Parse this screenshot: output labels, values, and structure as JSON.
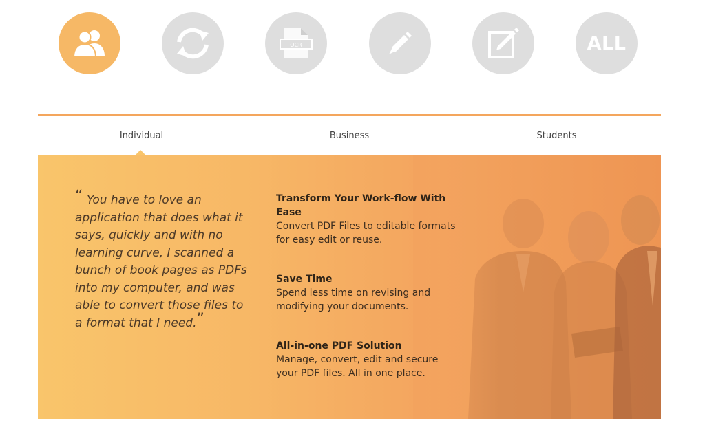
{
  "icon_tabs": [
    {
      "icon": "users-icon",
      "active": true
    },
    {
      "icon": "convert-icon",
      "active": false
    },
    {
      "icon": "ocr-icon",
      "active": false,
      "label": "OCR"
    },
    {
      "icon": "edit-icon",
      "active": false
    },
    {
      "icon": "sign-icon",
      "active": false
    },
    {
      "icon": "all-icon",
      "active": false,
      "label": "ALL"
    }
  ],
  "colors": {
    "accent": "#f4a65d",
    "active_icon": "#f6b866",
    "inactive_icon": "#dedede"
  },
  "tabs": [
    {
      "label": "Individual",
      "active": true
    },
    {
      "label": "Business",
      "active": false
    },
    {
      "label": "Students",
      "active": false
    }
  ],
  "testimonial": {
    "quote": "You have to love an application that does what it says, quickly and with no learning curve, I scanned a bunch of book pages as PDFs into my computer, and was able to convert those files to a format that I need.",
    "open_mark": "“",
    "close_mark": "”"
  },
  "features": [
    {
      "title": "Transform Your Work-flow With Ease",
      "text": "Convert PDF Files to editable formats for easy edit or reuse."
    },
    {
      "title": "Save Time",
      "text": "Spend less time on revising and modifying your documents."
    },
    {
      "title": "All-in-one PDF Solution",
      "text": "Manage, convert, edit and secure your PDF files. All in one place."
    }
  ]
}
